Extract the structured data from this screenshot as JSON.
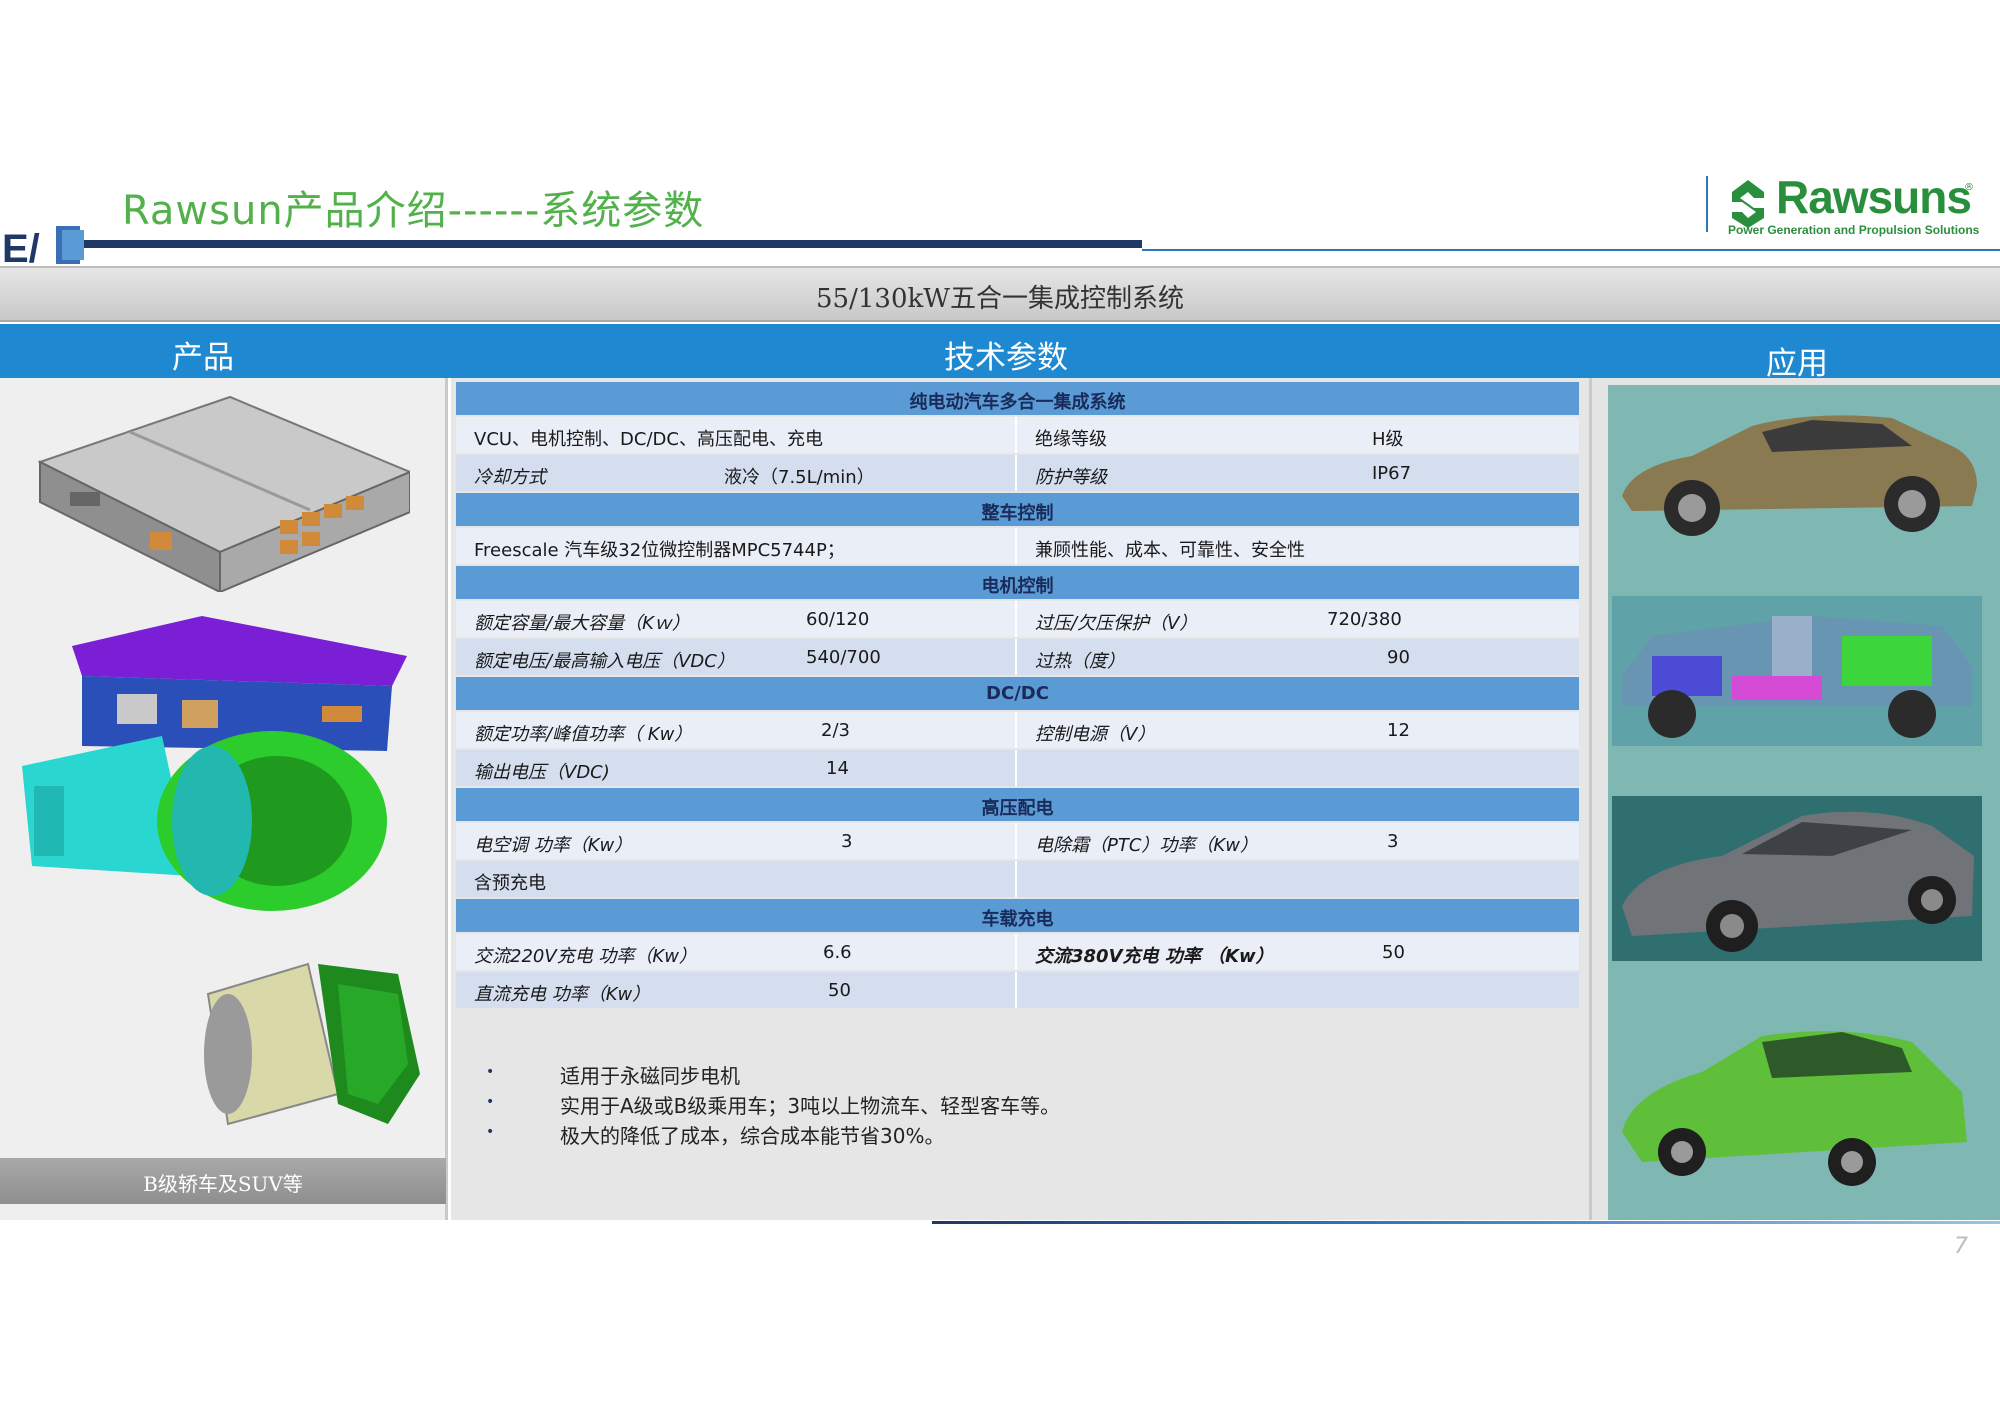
{
  "header": {
    "title": "Rawsun产品介绍------系统参数",
    "ev_logo_text": "E/",
    "brand": {
      "name": "Rawsuns",
      "registered": "®",
      "tagline": "Power Generation and Propulsion Solutions"
    }
  },
  "system_title": "55/130kW五合一集成控制系统",
  "columns": {
    "product": "产品",
    "tech": "技术参数",
    "application": "应用"
  },
  "product_caption": "B级轿车及SUV等",
  "spec": {
    "sections": [
      {
        "title": "纯电动汽车多合一集成系统",
        "rows": [
          {
            "l_label": "VCU、电机控制、DC/DC、高压配电、充电",
            "l_value": "",
            "r_label": "绝缘等级",
            "r_value": "H级"
          },
          {
            "l_label": "冷却方式",
            "l_value": "液冷（7.5L/min）",
            "r_label": "防护等级",
            "r_value": "IP67"
          }
        ]
      },
      {
        "title": "整车控制",
        "rows": [
          {
            "l_label": "Freescale 汽车级32位微控制器MPC5744P；",
            "l_value": "",
            "r_label": "兼顾性能、成本、可靠性、安全性",
            "r_value": ""
          }
        ]
      },
      {
        "title": "电机控制",
        "rows": [
          {
            "l_label": "额定容量/最大容量（Kｗ）",
            "l_value": "60/120",
            "r_label": "过压/欠压保护（V）",
            "r_value": "720/380"
          },
          {
            "l_label": "额定电压/最高输入电压（VDC）",
            "l_value": "540/700",
            "r_label": "过热（度）",
            "r_value": "90"
          }
        ]
      },
      {
        "title": "DC/DC",
        "rows": [
          {
            "l_label": "额定功率/峰值功率（ Kw）",
            "l_value": "2/3",
            "r_label": "控制电源（V）",
            "r_value": "12"
          },
          {
            "l_label": "输出电压（VDC)",
            "l_value": "14",
            "r_label": "",
            "r_value": ""
          }
        ]
      },
      {
        "title": "高压配电",
        "rows": [
          {
            "l_label": "电空调 功率（Kw）",
            "l_value": "3",
            "r_label": "电除霜（PTC）功率（Kw）",
            "r_value": "3"
          },
          {
            "l_label": "含预充电",
            "l_value": "",
            "r_label": "",
            "r_value": ""
          }
        ]
      },
      {
        "title": "车载充电",
        "rows": [
          {
            "l_label": "交流220V充电 功率（Kw）",
            "l_value": "6.6",
            "r_label": "交流380V充电 功率 （Kw）",
            "r_value": "50"
          },
          {
            "l_label": "直流充电 功率（Kw）",
            "l_value": "50",
            "r_label": "",
            "r_value": ""
          }
        ]
      }
    ]
  },
  "bullets": [
    "适用于永磁同步电机",
    "实用于A级或B级乘用车；3吨以上物流车、轻型客车等。",
    "极大的降低了成本，综合成本能节省30%。"
  ],
  "bullet_symbol": "•",
  "page_number": "7",
  "colors": {
    "title_green": "#52b14a",
    "brand_green": "#2a8f3c",
    "header_blue": "#1e88d0",
    "section_blue": "#5b9bd5",
    "navy": "#1f3864"
  }
}
